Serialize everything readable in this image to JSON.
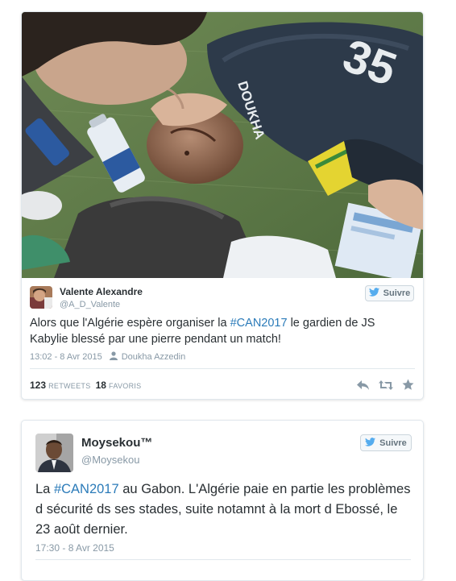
{
  "tweets": [
    {
      "name": "Valente Alexandre",
      "handle": "@A_D_Valente",
      "follow_label": "Suivre",
      "text_before": "Alors que l'Algérie espère organiser la ",
      "hashtag": "#CAN2017",
      "text_after": " le gardien de JS Kabylie blessé par une pierre pendant un match!",
      "timestamp": "13:02 - 8 Avr 2015",
      "photo_credit": "Doukha Azzedin",
      "retweets_count": "123",
      "retweets_label": "RETWEETS",
      "favorites_count": "18",
      "favorites_label": "FAVORIS",
      "photo_jersey_text": "DOUKHA",
      "photo_jersey_number": "35"
    },
    {
      "name": "Moysekou™",
      "handle": "@Moysekou",
      "follow_label": "Suivre",
      "text_before": "La ",
      "hashtag": "#CAN2017",
      "text_after": " au Gabon. L'Algérie paie en partie les problèmes d sécurité ds ses stades, suite notamnt à la mort d Ebossé, le 23 août dernier.",
      "timestamp": "17:30 - 8 Avr 2015"
    }
  ],
  "colors": {
    "link": "#2b7bb9",
    "twitter_bird": "#55acee",
    "muted": "#8899a6",
    "border": "#e1e8ed"
  },
  "icons": [
    "twitter-bird-icon",
    "person-icon",
    "reply-icon",
    "retweet-icon",
    "favorite-star-icon"
  ]
}
